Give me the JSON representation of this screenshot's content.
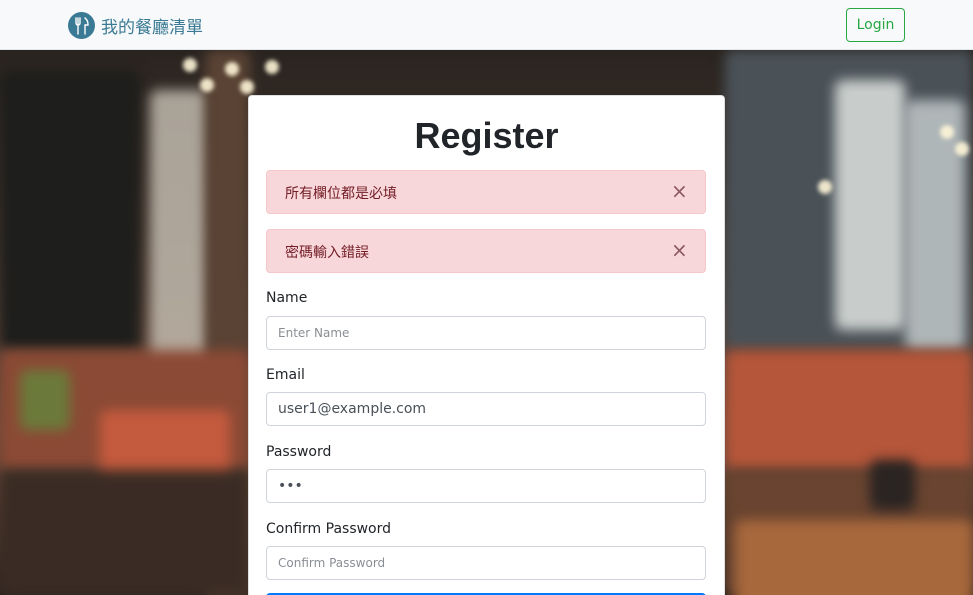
{
  "navbar": {
    "brand_text": "我的餐廳清單",
    "brand_icon": "fork-knife-icon",
    "login_label": "Login"
  },
  "form": {
    "title": "Register",
    "alerts": [
      {
        "message": "所有欄位都是必填",
        "close": "×"
      },
      {
        "message": "密碼輸入錯誤",
        "close": "×"
      }
    ],
    "fields": {
      "name": {
        "label": "Name",
        "placeholder": "Enter Name",
        "value": ""
      },
      "email": {
        "label": "Email",
        "placeholder": "",
        "value": "user1@example.com"
      },
      "password": {
        "label": "Password",
        "placeholder": "",
        "value": "•••"
      },
      "confirm_password": {
        "label": "Confirm Password",
        "placeholder": "Confirm Password",
        "value": ""
      }
    }
  },
  "colors": {
    "brand": "#3a7a94",
    "login": "#28a745",
    "alert_bg": "#f8d7da",
    "alert_text": "#721c24",
    "primary": "#007bff"
  }
}
